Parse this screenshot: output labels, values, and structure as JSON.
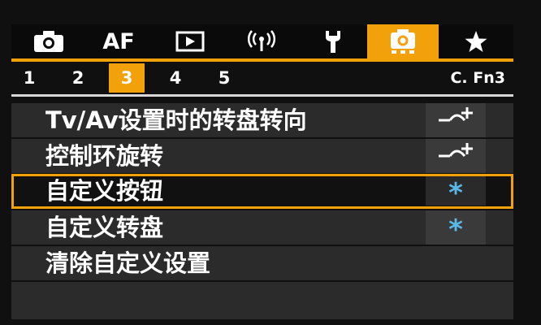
{
  "mode_tabs": [
    {
      "name": "shooting-tab",
      "icon": "camera-icon",
      "label": ""
    },
    {
      "name": "af-tab",
      "icon": "",
      "label": "AF"
    },
    {
      "name": "playback-tab",
      "icon": "play-icon",
      "label": ""
    },
    {
      "name": "wireless-tab",
      "icon": "wireless-icon",
      "label": ""
    },
    {
      "name": "setup-tab",
      "icon": "wrench-icon",
      "label": ""
    },
    {
      "name": "custom-functions-tab",
      "icon": "custom-camera-icon",
      "label": "",
      "active": true
    },
    {
      "name": "my-menu-tab",
      "icon": "star-icon",
      "label": ""
    }
  ],
  "sub_tabs": [
    "1",
    "2",
    "3",
    "4",
    "5"
  ],
  "active_sub_tab": "3",
  "section_code": "C. Fn3",
  "menu_items": [
    {
      "label": "Tv/Av设置时的转盘转向",
      "value_icon": "dial-direction-icon"
    },
    {
      "label": "控制环旋转",
      "value_icon": "dial-direction-icon"
    },
    {
      "label": "自定义按钮",
      "value": "*",
      "selected": true
    },
    {
      "label": "自定义转盘",
      "value": "*"
    },
    {
      "label": "清除自定义设置",
      "value": ""
    }
  ],
  "colors": {
    "accent": "#f3a10b",
    "value_blue": "#5ab8e8",
    "row_bg": "#2b2b2b"
  }
}
